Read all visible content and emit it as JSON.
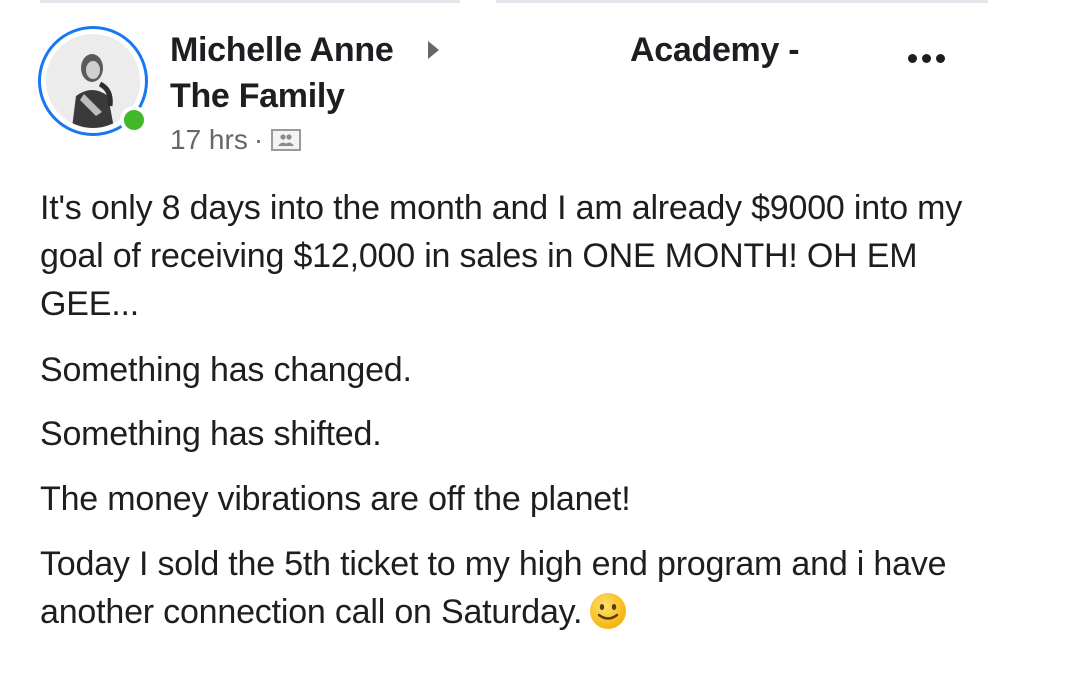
{
  "post": {
    "author": "Michelle Anne",
    "group_name_line1": "Academy -",
    "group_name_line2": "The Family",
    "timestamp": "17 hrs",
    "separator": "·",
    "audience_icon": "group-audience-icon",
    "more_icon": "more-options-icon",
    "online_status_color": "#42b72a",
    "story_ring_color": "#1877f2",
    "paragraphs": [
      "It's only 8 days into the month and I am already $9000 into my goal of receiving $12,000 in sales in ONE MONTH! OH EM GEE...",
      "Something has changed.",
      "Something has shifted.",
      "The money vibrations are off the planet!",
      "Today I sold the 5th ticket to my high end program and i have another connection call on Saturday."
    ],
    "emoji": "slightly-smiling-face-emoji"
  }
}
